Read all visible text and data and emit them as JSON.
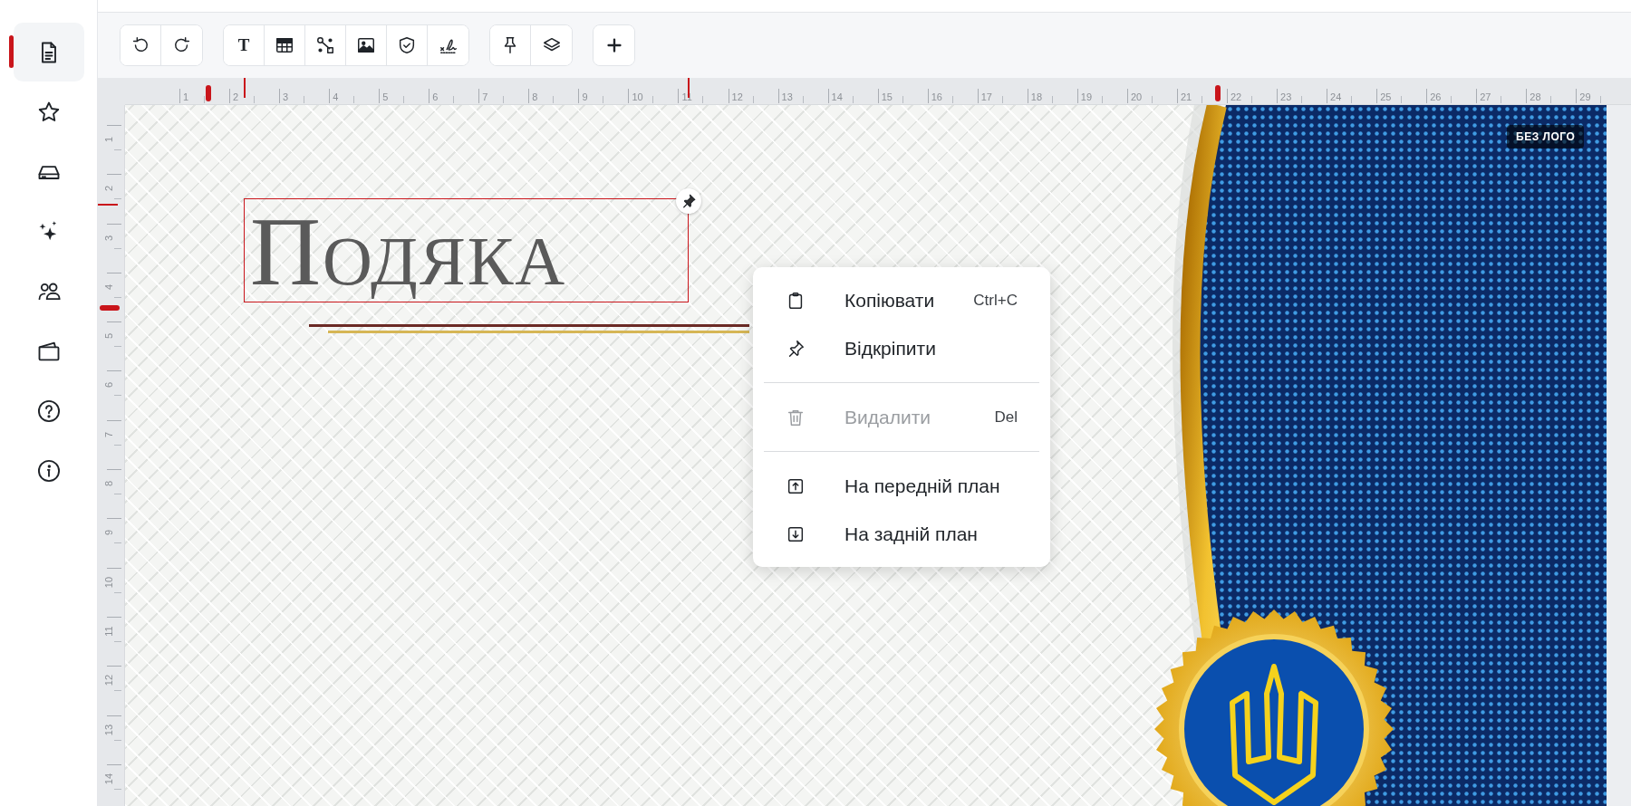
{
  "sidebar": {
    "items": [
      {
        "selected": true
      },
      {
        "selected": false
      },
      {
        "selected": false
      },
      {
        "selected": false
      },
      {
        "selected": false
      },
      {
        "selected": false
      },
      {
        "selected": false
      },
      {
        "selected": false
      }
    ]
  },
  "toolbar": {
    "text_tool_label": "T"
  },
  "top_ruler": {
    "labels": [
      "1",
      "2",
      "3",
      "4",
      "5",
      "6",
      "7",
      "8",
      "9",
      "10",
      "11",
      "12",
      "13",
      "14",
      "15",
      "16",
      "17",
      "18",
      "19",
      "20",
      "21",
      "22",
      "23",
      "24",
      "25",
      "26",
      "27",
      "28",
      "29"
    ]
  },
  "left_ruler": {
    "labels": [
      "1",
      "2",
      "3",
      "4",
      "5",
      "6",
      "7",
      "8",
      "9",
      "10",
      "11",
      "12",
      "13",
      "14"
    ]
  },
  "canvas": {
    "title": "Подяка",
    "title_selected": true,
    "title_pinned": true,
    "badge": "БЕЗ ЛОГО"
  },
  "context_menu": {
    "items": [
      {
        "kind": "item",
        "label": "Копіювати",
        "shortcut": "Ctrl+C",
        "disabled": false
      },
      {
        "kind": "item",
        "label": "Відкріпити",
        "disabled": false
      },
      {
        "kind": "separator"
      },
      {
        "kind": "item",
        "label": "Видалити",
        "shortcut": "Del",
        "disabled": true
      },
      {
        "kind": "separator"
      },
      {
        "kind": "item",
        "label": "На передній план",
        "disabled": false
      },
      {
        "kind": "item",
        "label": "На задній план",
        "disabled": false
      }
    ]
  }
}
